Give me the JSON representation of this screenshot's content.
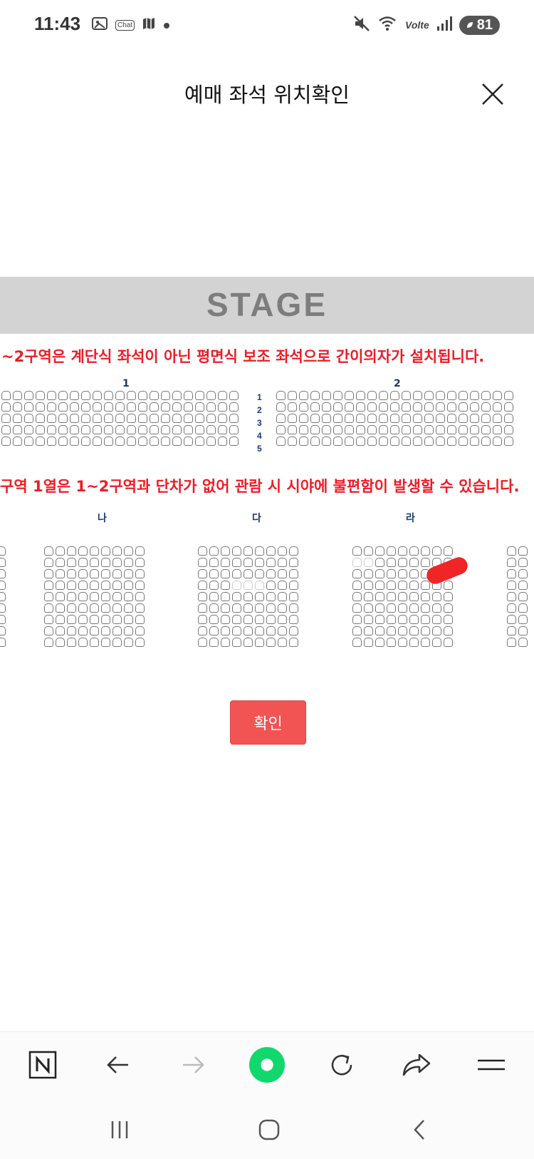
{
  "status_bar": {
    "time": "11:43",
    "chat_label": "Chat",
    "network_label": "Volte",
    "battery": "81",
    "icons": [
      "gallery-icon",
      "chat-icon",
      "map-icon",
      "dot-icon",
      "mute-icon",
      "wifi-icon",
      "signal-icon",
      "battery-icon"
    ]
  },
  "header": {
    "title": "예매 좌석 위치확인",
    "close_icon": "close-icon"
  },
  "seatmap": {
    "stage_label": "STAGE",
    "notice_1": "~2구역은 계단식 좌석이 아닌 평면식 보조 좌석으로 간이의자가 설치됩니다.",
    "notice_2": "구역 1열은 1~2구역과 단차가 없어 관람 시 시야에 불편함이 발생할 수 있습니다.",
    "upper_sections": [
      "1",
      "2"
    ],
    "row_numbers": [
      "1",
      "2",
      "3",
      "4",
      "5"
    ],
    "lower_sections": [
      "나",
      "다",
      "라"
    ],
    "accent_color": "#ee1c25",
    "marker_color": "#f02525"
  },
  "confirm_button": {
    "label": "확인",
    "color": "#f25454"
  },
  "browser_toolbar": {
    "icons": [
      "naver-home-icon",
      "back-arrow-icon",
      "forward-arrow-icon",
      "green-dot-icon",
      "refresh-icon",
      "share-icon",
      "menu-icon"
    ]
  },
  "system_nav": {
    "icons": [
      "recent-apps-icon",
      "home-icon",
      "back-icon"
    ]
  }
}
